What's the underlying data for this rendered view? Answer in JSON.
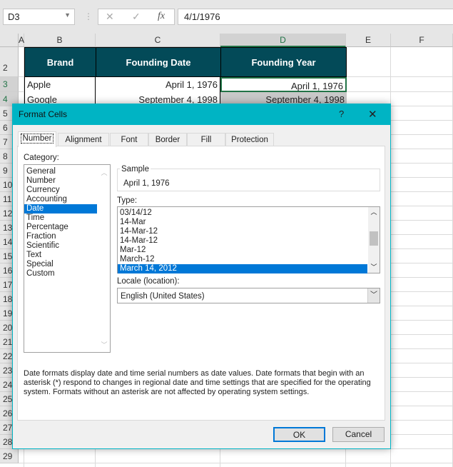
{
  "formula_bar": {
    "name_box": "D3",
    "fx": "fx",
    "cancel": "✕",
    "enter": "✓",
    "formula": "4/1/1976"
  },
  "columns": [
    "A",
    "B",
    "C",
    "D",
    "E",
    "F"
  ],
  "rows": [
    "2",
    "3",
    "4",
    "5",
    "6",
    "7",
    "8",
    "9",
    "10",
    "11",
    "12",
    "13",
    "14",
    "15",
    "16",
    "17",
    "18",
    "19",
    "20",
    "21",
    "22",
    "23",
    "24",
    "25",
    "26",
    "27",
    "28",
    "29"
  ],
  "table": {
    "headers": [
      "Brand",
      "Founding Date",
      "Founding Year"
    ],
    "data": [
      [
        "Apple",
        "April 1, 1976",
        "April 1, 1976"
      ],
      [
        "Google",
        "September 4, 1998",
        "September 4, 1998"
      ]
    ]
  },
  "dialog": {
    "title": "Format Cells",
    "help": "?",
    "close": "✕",
    "tabs": [
      "Number",
      "Alignment",
      "Font",
      "Border",
      "Fill",
      "Protection"
    ],
    "category_label": "Category:",
    "categories": [
      "General",
      "Number",
      "Currency",
      "Accounting",
      "Date",
      "Time",
      "Percentage",
      "Fraction",
      "Scientific",
      "Text",
      "Special",
      "Custom"
    ],
    "sample_label": "Sample",
    "sample_value": "April 1, 1976",
    "type_label": "Type:",
    "types": [
      "03/14/12",
      "14-Mar",
      "14-Mar-12",
      "14-Mar-12",
      "Mar-12",
      "March-12",
      "March 14, 2012"
    ],
    "locale_label": "Locale (location):",
    "locale_value": "English (United States)",
    "description": "Date formats display date and time serial numbers as date values.  Date formats that begin with an asterisk (*) respond to changes in regional date and time settings that are specified for the operating system. Formats without an asterisk are not affected by operating system settings.",
    "ok": "OK",
    "cancel": "Cancel"
  },
  "colors": {
    "accent": "#00b4c4",
    "header_fill": "#034a58",
    "selection": "#0078d7"
  }
}
